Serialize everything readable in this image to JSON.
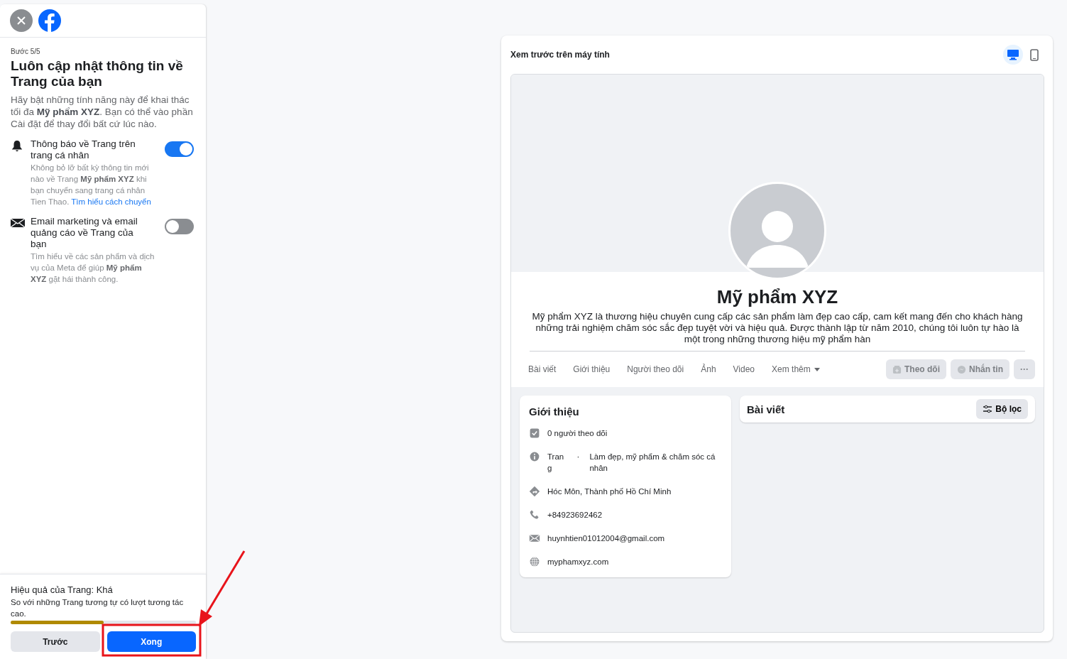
{
  "sidebar": {
    "step": "Bước 5/5",
    "title": "Luôn cập nhật thông tin về Trang của bạn",
    "intro": "Hãy bật những tính năng này để khai thác tối đa **Mỹ phẩm XYZ**. Bạn có thể vào phần Cài đặt để thay đổi bất cứ lúc nào.",
    "settings": [
      {
        "kind": "bell",
        "title": "Thông báo về Trang trên trang cá nhân",
        "description": "Không bỏ lỡ bất kỳ thông tin mới nào về Trang **Mỹ phẩm XYZ** khi bạn chuyển sang trang cá nhân Tien Thao.",
        "link": "Tìm hiểu cách chuyển",
        "on": true
      },
      {
        "kind": "mail",
        "title": "Email marketing và email quảng cáo về Trang của bạn",
        "description": "Tìm hiểu về các sản phẩm và dịch vụ của Meta để giúp **Mỹ phẩm XYZ** gặt hái thành công.",
        "on": false
      }
    ],
    "performance": {
      "title": "Hiệu quả của Trang: Khá",
      "description": "So với những Trang tương tự có lượt tương tác cao.",
      "level": 0.5
    },
    "buttons": [
      {
        "label": "Trước",
        "kind": "secondary"
      },
      {
        "label": "Xong",
        "kind": "primary"
      }
    ]
  },
  "preview": {
    "title": "Xem trước trên máy tính",
    "views": [
      {
        "kind": "desktop",
        "selected": true
      },
      {
        "kind": "mobile",
        "selected": false
      }
    ],
    "page_name": "Mỹ phẩm XYZ",
    "bio": "Mỹ phẩm XYZ là thương hiệu chuyên cung cấp các sản phẩm làm đẹp cao cấp, cam kết mang đến cho khách hàng những trải nghiệm chăm sóc sắc đẹp tuyệt vời và hiệu quả. Được thành lập từ năm 2010, chúng tôi luôn tự hào là một trong những thương hiệu mỹ phẩm hàn",
    "tabs": [
      {
        "label": "Bài viết",
        "dropdown": false
      },
      {
        "label": "Giới thiệu",
        "dropdown": false
      },
      {
        "label": "Người theo dõi",
        "dropdown": false
      },
      {
        "label": "Ảnh",
        "dropdown": false
      },
      {
        "label": "Video",
        "dropdown": false
      },
      {
        "label": "Xem thêm",
        "dropdown": true
      }
    ],
    "actions": [
      {
        "kind": "follow",
        "label": "Theo dõi",
        "disabled": true
      },
      {
        "kind": "message",
        "label": "Nhắn tin",
        "disabled": true
      },
      {
        "kind": "more",
        "label": "···",
        "disabled": true
      }
    ],
    "intro": {
      "title": "Giới thiệu",
      "items": [
        {
          "kind": "followers",
          "text": "0 người theo dõi"
        },
        {
          "kind": "category",
          "label": "Trang",
          "separator": "·",
          "text": "Làm đẹp, mỹ phẩm & chăm sóc cá nhân"
        },
        {
          "kind": "location",
          "text": "Hóc Môn, Thành phố Hồ Chí Minh"
        },
        {
          "kind": "phone",
          "text": "+84923692462"
        },
        {
          "kind": "email",
          "text": "huynhtien01012004@gmail.com"
        },
        {
          "kind": "website",
          "text": "myphamxyz.com"
        }
      ]
    },
    "posts": {
      "title": "Bài viết",
      "filter": "Bộ lọc"
    }
  }
}
